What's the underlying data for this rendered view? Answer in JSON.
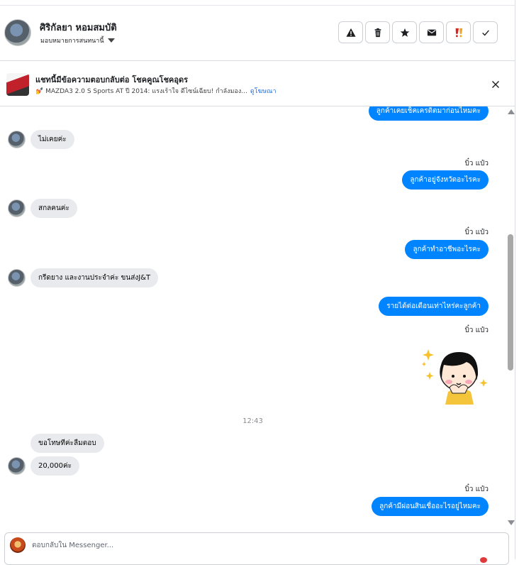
{
  "header": {
    "contact_name": "ศิริกัลยา หอมสมบัติ",
    "assign_label": "มอบหมายการสนทนานี้",
    "actions": [
      {
        "name": "report-spam-icon"
      },
      {
        "name": "delete-icon"
      },
      {
        "name": "star-icon"
      },
      {
        "name": "mark-unread-icon"
      },
      {
        "name": "follow-up-icon"
      },
      {
        "name": "mark-done-icon"
      }
    ]
  },
  "ad_banner": {
    "title": "แชทนี้มีข้อความตอบกลับต่อ โชคคูณโชคอุดร",
    "description": "💅 MAZDA3 2.0 S Sports AT ปี 2014: แรงเร้าใจ ดีไซน์เฉียบ! กำลังมอง...",
    "link_label": "ดูโฆษณา"
  },
  "messages": {
    "m1": "ลูกค้าเคยเช็คเครดิตมาก่อนไหมคะ",
    "m2": "ไม่เคยค่ะ",
    "s1": "บิ๋ว แป๋ว",
    "m3": "ลูกค้าอยู่จังหวัดอะไรคะ",
    "m4": "สกลคนค่ะ",
    "s2": "บิ๋ว แป๋ว",
    "m5": "ลูกค้าทำอาชีพอะไรคะ",
    "m6": "กรีดยาง และงานประจำค่ะ ขนส่งJ&T",
    "m7": "รายได้ต่อเดือนเท่าไหร่คะลูกค้า",
    "s3": "บิ๋ว แป๋ว",
    "time": "12:43",
    "m8": "ขอโทษทีค่ะลืมตอบ",
    "m9": "20,000ค่ะ",
    "s4": "บิ๋ว แป๋ว",
    "m10": "ลูกค้ามีผ่อนสินเชื่ออะไรอยู่ไหมคะ"
  },
  "composer": {
    "placeholder": "ตอบกลับใน Messenger..."
  },
  "colors": {
    "outgoing_bubble": "#0084ff",
    "incoming_bubble": "#e9eaed",
    "link": "#216fdb"
  }
}
